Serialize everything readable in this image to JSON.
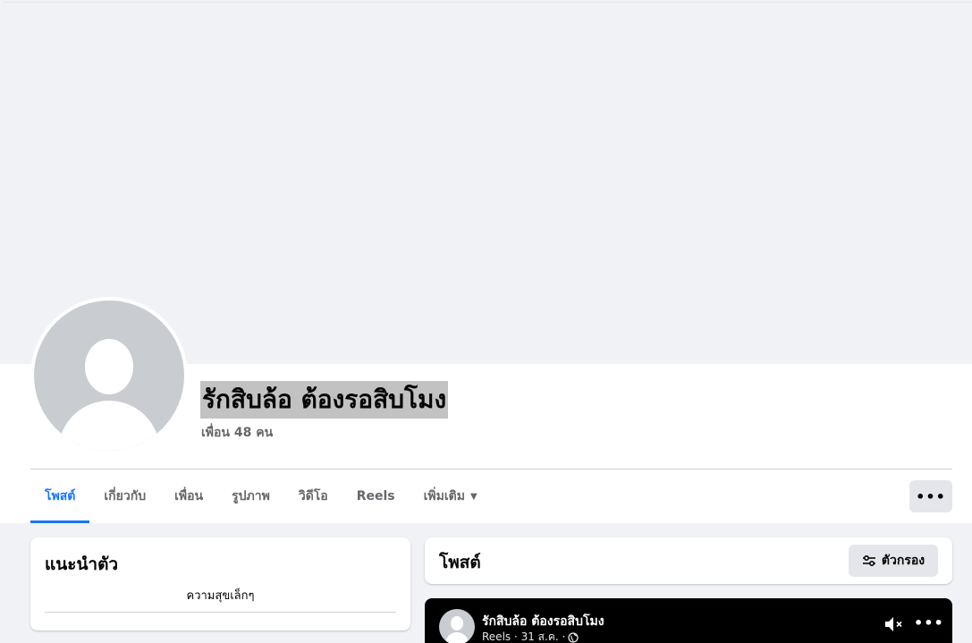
{
  "profile": {
    "name": "รักสิบล้อ ต้องรอสิบโมง",
    "friends": "เพื่อน 48 คน"
  },
  "tabs": [
    {
      "label": "โพสต์"
    },
    {
      "label": "เกี่ยวกับ"
    },
    {
      "label": "เพื่อน"
    },
    {
      "label": "รูปภาพ"
    },
    {
      "label": "วิดีโอ"
    },
    {
      "label": "Reels"
    },
    {
      "label": "เพิ่มเติม"
    }
  ],
  "more_button": "•••",
  "intro": {
    "title": "แนะนำตัว",
    "bio": "ความสุขเล็กๆ"
  },
  "posts": {
    "title": "โพสต์",
    "filter_label": "ตัวกรอง"
  },
  "reel": {
    "author": "รักสิบล้อ ต้องรอสิบโมง",
    "meta": "Reels · 31 ส.ค. ·",
    "more": "•••"
  },
  "colors": {
    "accent": "#1877f2",
    "background": "#f0f2f5",
    "muted_text": "#65676b",
    "button_gray": "#e4e6eb",
    "name_highlight": "#c2c2c2"
  }
}
